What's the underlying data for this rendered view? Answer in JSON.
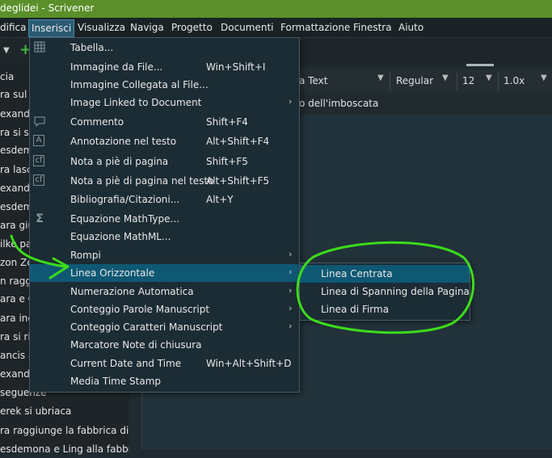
{
  "window": {
    "title": "deglidei - Scrivener"
  },
  "menubar": [
    {
      "label": "difica"
    },
    {
      "label": "Inserisci"
    },
    {
      "label": "Visualizza"
    },
    {
      "label": "Naviga"
    },
    {
      "label": "Progetto"
    },
    {
      "label": "Documenti"
    },
    {
      "label": "Formattazione"
    },
    {
      "label": "Finestra"
    },
    {
      "label": "Aiuto"
    }
  ],
  "binder": {
    "items": [
      "cia",
      "ra sul T",
      "exande",
      "ra si sep",
      "esdemo",
      "ra lascia",
      "exande",
      "esdemo",
      "ara giu",
      "ilke par",
      "zon Ze",
      "n raggiu",
      "ara e Ch",
      "ara inc",
      "ra si riu",
      "ancis ac",
      "exande",
      "seguenze",
      "erek si ubriaca",
      "ra raggiunge la fabbrica di an...",
      "esdemona e Ling alla fabbric..."
    ]
  },
  "format_bar": {
    "style": "a Text",
    "weight": "Regular",
    "size": "12",
    "spacing": "1.0x"
  },
  "document": {
    "title": "o dell'imboscata"
  },
  "menu": {
    "items": [
      {
        "label": "Tabella...",
        "shortcut": "",
        "icon": "table-icon"
      },
      {
        "label": "Immagine da File...",
        "shortcut": "Win+Shift+I",
        "icon": ""
      },
      {
        "label": "Immagine Collegata al File...",
        "shortcut": "",
        "icon": ""
      },
      {
        "label": "Image Linked to Document",
        "shortcut": "",
        "icon": ""
      },
      {
        "label": "Commento",
        "shortcut": "Shift+F4",
        "icon": "comment-icon"
      },
      {
        "label": "Annotazione nel testo",
        "shortcut": "Alt+Shift+F4",
        "icon": "annotation-icon"
      },
      {
        "label": "Nota a piè di pagina",
        "shortcut": "Shift+F5",
        "icon": "footnote-icon"
      },
      {
        "label": "Nota a piè di pagina nel testo",
        "shortcut": "Alt+Shift+F5",
        "icon": "inline-footnote-icon"
      },
      {
        "label": "Bibliografia/Citazioni...",
        "shortcut": "Alt+Y",
        "icon": ""
      },
      {
        "label": "Equazione MathType...",
        "shortcut": "",
        "icon": "sigma-icon"
      },
      {
        "label": "Equazione MathML...",
        "shortcut": "",
        "icon": ""
      },
      {
        "label": "Rompi",
        "shortcut": "",
        "icon": ""
      },
      {
        "label": "Linea Orizzontale",
        "shortcut": "",
        "icon": ""
      },
      {
        "label": "Numerazione Automatica",
        "shortcut": "",
        "icon": ""
      },
      {
        "label": "Conteggio Parole Manuscript",
        "shortcut": "",
        "icon": ""
      },
      {
        "label": "Conteggio Caratteri Manuscript",
        "shortcut": "",
        "icon": ""
      },
      {
        "label": "Marcatore Note di chiusura",
        "shortcut": "",
        "icon": ""
      },
      {
        "label": "Current Date and Time",
        "shortcut": "Win+Alt+Shift+D",
        "icon": ""
      },
      {
        "label": "Media Time Stamp",
        "shortcut": "",
        "icon": ""
      }
    ]
  },
  "submenu": {
    "items": [
      {
        "label": "Linea Centrata"
      },
      {
        "label": "Linea di Spanning della Pagina"
      },
      {
        "label": "Linea di Firma"
      }
    ]
  },
  "colors": {
    "title_bar": "#5a8f29",
    "highlight": "#0f5873",
    "annotation": "#3ddc1a"
  }
}
